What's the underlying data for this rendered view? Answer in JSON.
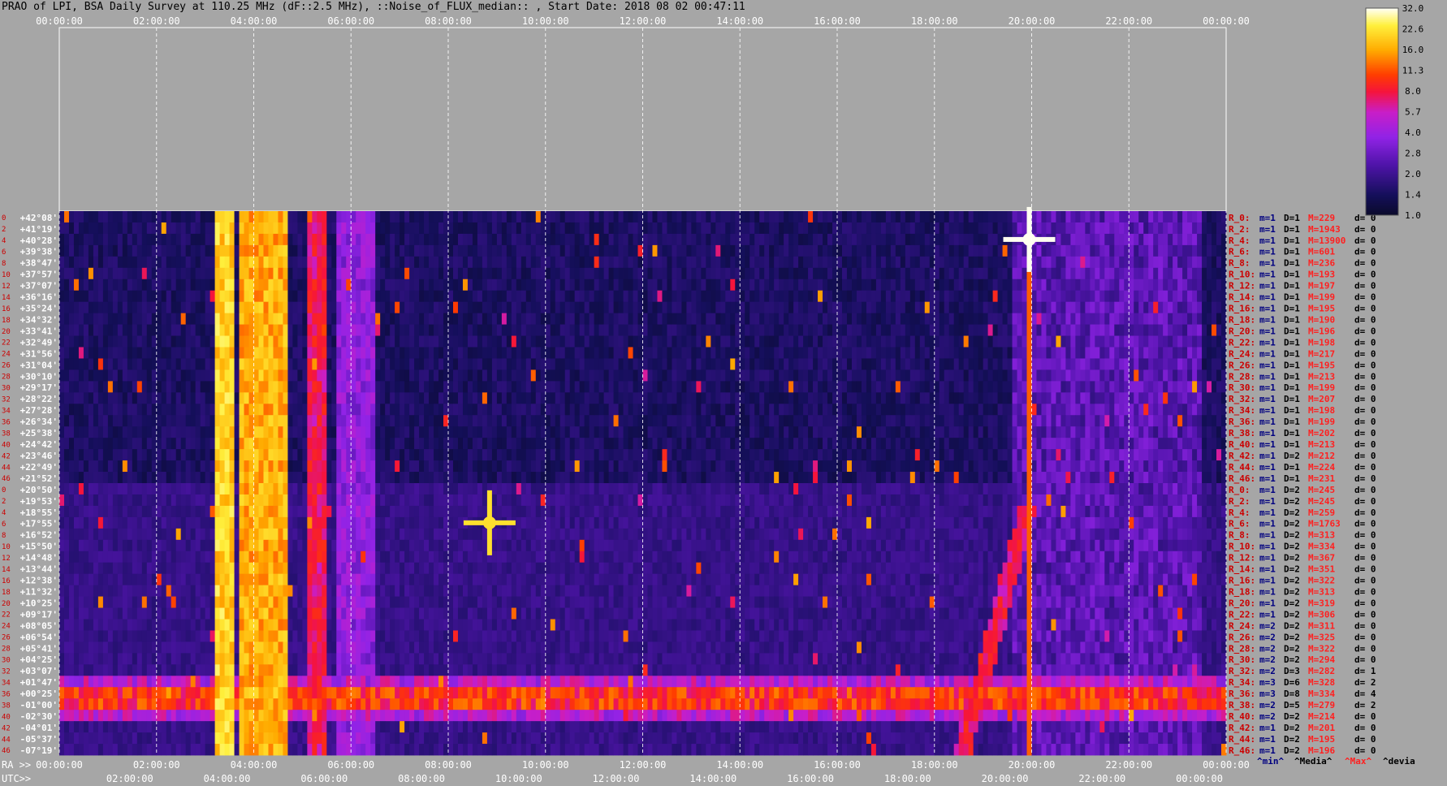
{
  "title": "PRAO of LPI, BSA Daily Survey at 110.25 MHz (dF::2.5 MHz), ::Noise_of_FLUX_median:: , Start Date: 2018 08 02 00:47:11",
  "axis": {
    "ra_prefix": "RA >>",
    "utc_prefix": "UTC>>",
    "top_ticks": [
      "00:00:00",
      "02:00:00",
      "04:00:00",
      "06:00:00",
      "08:00:00",
      "10:00:00",
      "12:00:00",
      "14:00:00",
      "16:00:00",
      "18:00:00",
      "20:00:00",
      "22:00:00",
      "00:00:00"
    ],
    "ra_ticks": [
      "00:00:00",
      "02:00:00",
      "04:00:00",
      "06:00:00",
      "08:00:00",
      "10:00:00",
      "12:00:00",
      "14:00:00",
      "16:00:00",
      "18:00:00",
      "20:00:00",
      "22:00:00",
      "00:00:00"
    ],
    "utc_ticks": [
      "02:00:00",
      "04:00:00",
      "06:00:00",
      "08:00:00",
      "10:00:00",
      "12:00:00",
      "14:00:00",
      "16:00:00",
      "18:00:00",
      "20:00:00",
      "22:00:00",
      "00:00:00"
    ]
  },
  "declinations": [
    "+42°08'",
    "+41°19'",
    "+40°28'",
    "+39°38'",
    "+38°47'",
    "+37°57'",
    "+37°07'",
    "+36°16'",
    "+35°24'",
    "+34°32'",
    "+33°41'",
    "+32°49'",
    "+31°56'",
    "+31°04'",
    "+30°10'",
    "+29°17'",
    "+28°22'",
    "+27°28'",
    "+26°34'",
    "+25°38'",
    "+24°42'",
    "+23°46'",
    "+22°49'",
    "+21°52'",
    "+20°50'",
    "+19°53'",
    "+18°55'",
    "+17°55'",
    "+16°52'",
    "+15°50'",
    "+14°48'",
    "+13°44'",
    "+12°38'",
    "+11°32'",
    "+10°25'",
    "+09°17'",
    "+08°05'",
    "+06°54'",
    "+05°41'",
    "+04°25'",
    "+03°07'",
    "+01°47'",
    "+00°25'",
    "-01°00'",
    "-02°30'",
    "-04°01'",
    "-05°37'",
    "-07°19'"
  ],
  "beam_numbers": [
    "0",
    "2",
    "4",
    "6",
    "8",
    "10",
    "12",
    "14",
    "16",
    "18",
    "20",
    "22",
    "24",
    "26",
    "28",
    "30",
    "32",
    "34",
    "36",
    "38",
    "40",
    "42",
    "44",
    "46",
    "0",
    "2",
    "4",
    "6",
    "8",
    "10",
    "12",
    "14",
    "16",
    "18",
    "20",
    "22",
    "24",
    "26",
    "28",
    "30",
    "32",
    "34",
    "36",
    "38",
    "40",
    "42",
    "44",
    "46"
  ],
  "beams": [
    {
      "r": "R_0:",
      "m": "m=1",
      "d": "D=1",
      "mx": "M=229",
      "dv": "d= 0"
    },
    {
      "r": "R_2:",
      "m": "m=1",
      "d": "D=1",
      "mx": "M=1943",
      "dv": "d= 0"
    },
    {
      "r": "R_4:",
      "m": "m=1",
      "d": "D=1",
      "mx": "M=13900",
      "dv": "d= 0"
    },
    {
      "r": "R_6:",
      "m": "m=1",
      "d": "D=1",
      "mx": "M=601",
      "dv": "d= 0"
    },
    {
      "r": "R_8:",
      "m": "m=1",
      "d": "D=1",
      "mx": "M=236",
      "dv": "d= 0"
    },
    {
      "r": "R_10:",
      "m": "m=1",
      "d": "D=1",
      "mx": "M=193",
      "dv": "d= 0"
    },
    {
      "r": "R_12:",
      "m": "m=1",
      "d": "D=1",
      "mx": "M=197",
      "dv": "d= 0"
    },
    {
      "r": "R_14:",
      "m": "m=1",
      "d": "D=1",
      "mx": "M=199",
      "dv": "d= 0"
    },
    {
      "r": "R_16:",
      "m": "m=1",
      "d": "D=1",
      "mx": "M=195",
      "dv": "d= 0"
    },
    {
      "r": "R_18:",
      "m": "m=1",
      "d": "D=1",
      "mx": "M=190",
      "dv": "d= 0"
    },
    {
      "r": "R_20:",
      "m": "m=1",
      "d": "D=1",
      "mx": "M=196",
      "dv": "d= 0"
    },
    {
      "r": "R_22:",
      "m": "m=1",
      "d": "D=1",
      "mx": "M=198",
      "dv": "d= 0"
    },
    {
      "r": "R_24:",
      "m": "m=1",
      "d": "D=1",
      "mx": "M=217",
      "dv": "d= 0"
    },
    {
      "r": "R_26:",
      "m": "m=1",
      "d": "D=1",
      "mx": "M=195",
      "dv": "d= 0"
    },
    {
      "r": "R_28:",
      "m": "m=1",
      "d": "D=1",
      "mx": "M=213",
      "dv": "d= 0"
    },
    {
      "r": "R_30:",
      "m": "m=1",
      "d": "D=1",
      "mx": "M=199",
      "dv": "d= 0"
    },
    {
      "r": "R_32:",
      "m": "m=1",
      "d": "D=1",
      "mx": "M=207",
      "dv": "d= 0"
    },
    {
      "r": "R_34:",
      "m": "m=1",
      "d": "D=1",
      "mx": "M=198",
      "dv": "d= 0"
    },
    {
      "r": "R_36:",
      "m": "m=1",
      "d": "D=1",
      "mx": "M=199",
      "dv": "d= 0"
    },
    {
      "r": "R_38:",
      "m": "m=1",
      "d": "D=1",
      "mx": "M=202",
      "dv": "d= 0"
    },
    {
      "r": "R_40:",
      "m": "m=1",
      "d": "D=1",
      "mx": "M=213",
      "dv": "d= 0"
    },
    {
      "r": "R_42:",
      "m": "m=1",
      "d": "D=2",
      "mx": "M=212",
      "dv": "d= 0"
    },
    {
      "r": "R_44:",
      "m": "m=1",
      "d": "D=1",
      "mx": "M=224",
      "dv": "d= 0"
    },
    {
      "r": "R_46:",
      "m": "m=1",
      "d": "D=1",
      "mx": "M=231",
      "dv": "d= 0"
    },
    {
      "r": "R_0:",
      "m": "m=1",
      "d": "D=2",
      "mx": "M=245",
      "dv": "d= 0"
    },
    {
      "r": "R_2:",
      "m": "m=1",
      "d": "D=2",
      "mx": "M=245",
      "dv": "d= 0"
    },
    {
      "r": "R_4:",
      "m": "m=1",
      "d": "D=2",
      "mx": "M=259",
      "dv": "d= 0"
    },
    {
      "r": "R_6:",
      "m": "m=1",
      "d": "D=2",
      "mx": "M=1763",
      "dv": "d= 0"
    },
    {
      "r": "R_8:",
      "m": "m=1",
      "d": "D=2",
      "mx": "M=313",
      "dv": "d= 0"
    },
    {
      "r": "R_10:",
      "m": "m=1",
      "d": "D=2",
      "mx": "M=334",
      "dv": "d= 0"
    },
    {
      "r": "R_12:",
      "m": "m=1",
      "d": "D=2",
      "mx": "M=367",
      "dv": "d= 0"
    },
    {
      "r": "R_14:",
      "m": "m=1",
      "d": "D=2",
      "mx": "M=351",
      "dv": "d= 0"
    },
    {
      "r": "R_16:",
      "m": "m=1",
      "d": "D=2",
      "mx": "M=322",
      "dv": "d= 0"
    },
    {
      "r": "R_18:",
      "m": "m=1",
      "d": "D=2",
      "mx": "M=313",
      "dv": "d= 0"
    },
    {
      "r": "R_20:",
      "m": "m=1",
      "d": "D=2",
      "mx": "M=319",
      "dv": "d= 0"
    },
    {
      "r": "R_22:",
      "m": "m=1",
      "d": "D=2",
      "mx": "M=306",
      "dv": "d= 0"
    },
    {
      "r": "R_24:",
      "m": "m=2",
      "d": "D=2",
      "mx": "M=311",
      "dv": "d= 0"
    },
    {
      "r": "R_26:",
      "m": "m=2",
      "d": "D=2",
      "mx": "M=325",
      "dv": "d= 0"
    },
    {
      "r": "R_28:",
      "m": "m=2",
      "d": "D=2",
      "mx": "M=322",
      "dv": "d= 0"
    },
    {
      "r": "R_30:",
      "m": "m=2",
      "d": "D=2",
      "mx": "M=294",
      "dv": "d= 0"
    },
    {
      "r": "R_32:",
      "m": "m=2",
      "d": "D=3",
      "mx": "M=282",
      "dv": "d= 1"
    },
    {
      "r": "R_34:",
      "m": "m=3",
      "d": "D=6",
      "mx": "M=328",
      "dv": "d= 2"
    },
    {
      "r": "R_36:",
      "m": "m=3",
      "d": "D=8",
      "mx": "M=334",
      "dv": "d= 4"
    },
    {
      "r": "R_38:",
      "m": "m=2",
      "d": "D=5",
      "mx": "M=279",
      "dv": "d= 2"
    },
    {
      "r": "R_40:",
      "m": "m=2",
      "d": "D=2",
      "mx": "M=214",
      "dv": "d= 0"
    },
    {
      "r": "R_42:",
      "m": "m=1",
      "d": "D=2",
      "mx": "M=201",
      "dv": "d= 0"
    },
    {
      "r": "R_44:",
      "m": "m=1",
      "d": "D=2",
      "mx": "M=195",
      "dv": "d= 0"
    },
    {
      "r": "R_46:",
      "m": "m=1",
      "d": "D=2",
      "mx": "M=196",
      "dv": "d= 0"
    }
  ],
  "legend_footer": {
    "min": "^min^",
    "media": "^Media^",
    "max": "^Max^",
    "devia": "^devia"
  },
  "colors": {
    "r_label": "#cc0000",
    "m_value": "#000080",
    "max_value": "#ff2020",
    "min_label": "#000080",
    "max_label": "#ff2020",
    "background": "#a6a6a6"
  },
  "chart_data": {
    "type": "heatmap",
    "title": "PRAO of LPI, BSA Daily Survey at 110.25 MHz (dF::2.5 MHz), ::Noise_of_FLUX_median:: , Start Date: 2018 08 02 00:47:11",
    "x_axis": {
      "label_ra": "RA",
      "label_utc": "UTC",
      "range": [
        "00:00:00",
        "24:00:00"
      ]
    },
    "y_axis": {
      "rows": 48,
      "range": [
        "+42°08'",
        "-07°19'"
      ]
    },
    "colorbar": {
      "ticks": [
        "32.0",
        "22.6",
        "16.0",
        "11.3",
        "8.0",
        "5.7",
        "4.0",
        "2.8",
        "2.0",
        "1.4",
        "1.0"
      ],
      "range": [
        1.0,
        32.0
      ],
      "scale": "log"
    },
    "features": [
      {
        "kind": "vertical-band",
        "ra_hours": [
          3.2,
          3.55
        ],
        "level": 22
      },
      {
        "kind": "vertical-band",
        "ra_hours": [
          3.7,
          4.7
        ],
        "level": 18
      },
      {
        "kind": "vertical-band",
        "ra_hours": [
          5.15,
          5.5
        ],
        "level": 8
      },
      {
        "kind": "vertical-band",
        "ra_hours": [
          5.7,
          6.5
        ],
        "level": 4
      },
      {
        "kind": "horizontal-band",
        "rows": [
          41,
          44
        ],
        "ra_hours": [
          0,
          24
        ],
        "level": 14
      },
      {
        "kind": "point-source",
        "ra_hours": 19.95,
        "row": 2,
        "level": 32
      },
      {
        "kind": "point-source",
        "ra_hours": 8.85,
        "row": 27,
        "level": 22
      },
      {
        "kind": "diagonal-trail",
        "ra_hours": [
          18.6,
          19.9
        ],
        "rows": [
          47,
          26
        ],
        "level": 8
      },
      {
        "kind": "vertical-line",
        "ra_hours": 19.95,
        "rows": [
          2,
          47
        ],
        "level": 12
      },
      {
        "kind": "diffuse",
        "ra_hours": [
          19.6,
          23.5
        ],
        "rows": [
          0,
          47
        ],
        "level": 2.6
      }
    ]
  }
}
